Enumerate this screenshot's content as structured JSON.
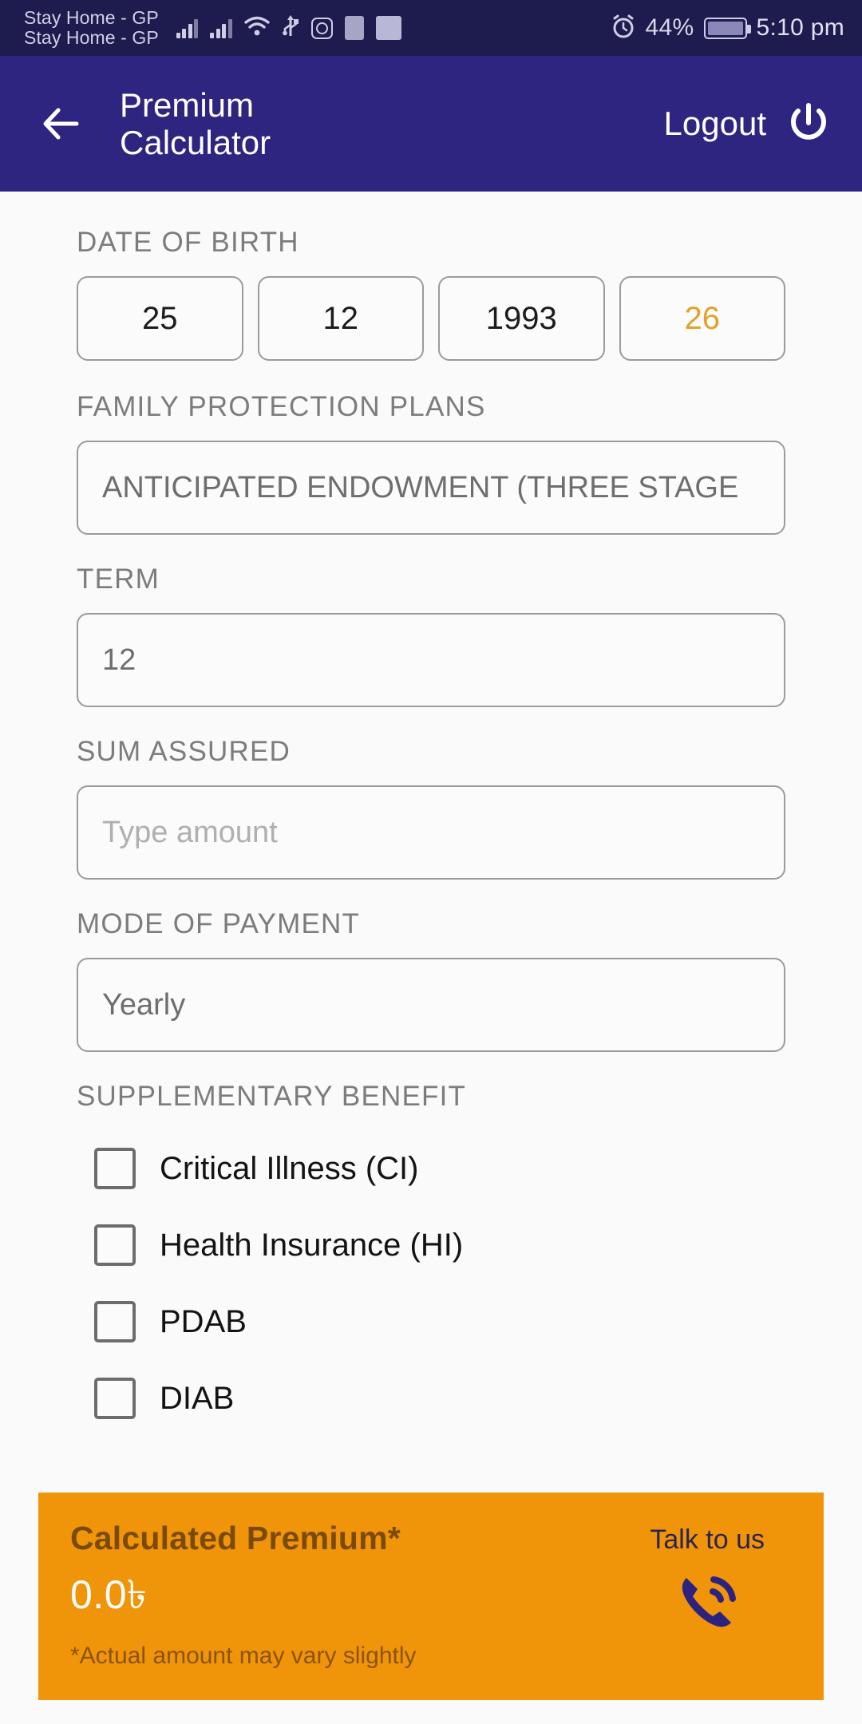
{
  "status_bar": {
    "carrier_line1": "Stay Home - GP",
    "carrier_line2": "Stay Home - GP",
    "battery_percent": "44%",
    "time": "5:10 pm",
    "icons": [
      "signal-icon",
      "signal-icon",
      "wifi-icon",
      "usb-icon",
      "instagram-icon",
      "notification-app-icon",
      "notification-app-icon",
      "alarm-icon",
      "battery-charging-icon"
    ]
  },
  "app_bar": {
    "back_icon": "arrow-left-icon",
    "title": "Premium\nCalculator",
    "title_line1": "Premium",
    "title_line2": "Calculator",
    "logout_label": "Logout",
    "power_icon": "power-icon"
  },
  "form": {
    "dob": {
      "label": "DATE OF BIRTH",
      "day": "25",
      "month": "12",
      "year": "1993",
      "age": "26"
    },
    "plan": {
      "label": "FAMILY PROTECTION PLANS",
      "value": "ANTICIPATED ENDOWMENT (THREE STAGE"
    },
    "term": {
      "label": "TERM",
      "value": "12"
    },
    "sum_assured": {
      "label": "SUM ASSURED",
      "value": "",
      "placeholder": "Type amount"
    },
    "mode_of_payment": {
      "label": "MODE OF PAYMENT",
      "value": "Yearly"
    },
    "supplementary_benefit": {
      "label": "SUPPLEMENTARY BENEFIT",
      "options": [
        {
          "label": "Critical Illness (CI)",
          "checked": false
        },
        {
          "label": "Health Insurance (HI)",
          "checked": false
        },
        {
          "label": "PDAB",
          "checked": false
        },
        {
          "label": "DIAB",
          "checked": false
        }
      ]
    }
  },
  "footer": {
    "title": "Calculated Premium*",
    "amount": "0.0৳",
    "note": "*Actual amount may vary slightly",
    "talk_label": "Talk to us",
    "phone_icon": "phone-call-icon"
  },
  "colors": {
    "status_bar": "#1E1B4E",
    "app_bar": "#2E2580",
    "accent_orange": "#F0940A",
    "age_orange": "#E2A12B",
    "page_bg": "#FAFAFA"
  }
}
